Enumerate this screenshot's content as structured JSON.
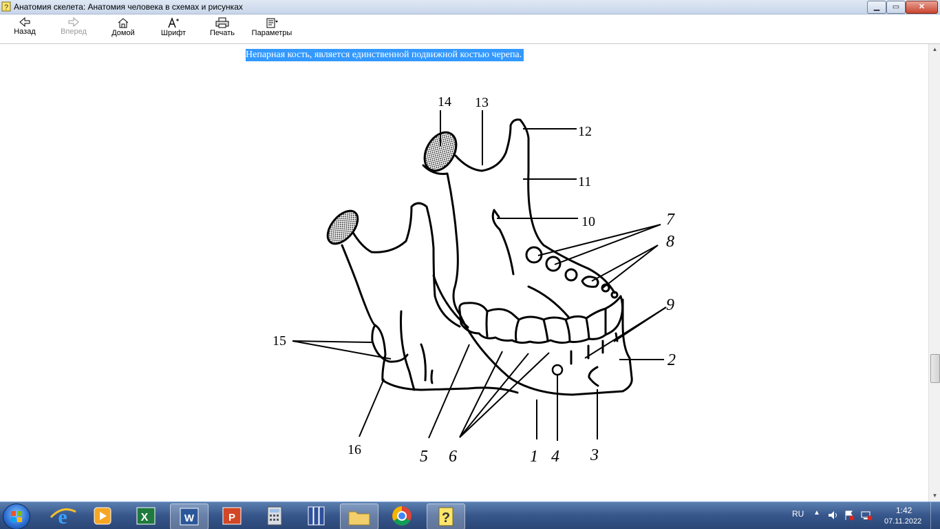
{
  "window": {
    "title": "Анатомия скелета: Анатомия человека в схемах и рисунках",
    "minimize_glyph": "▁",
    "maximize_glyph": "▭",
    "close_glyph": "✕"
  },
  "toolbar": {
    "back_label": "Назад",
    "forward_label": "Вперед",
    "home_label": "Домой",
    "font_label": "Шрифт",
    "print_label": "Печать",
    "options_label": "Параметры"
  },
  "content": {
    "selected_text": "Непарная кость, является единственной подвижной костью черепа."
  },
  "figure": {
    "labels": {
      "l1": "1",
      "l2": "2",
      "l3": "3",
      "l4": "4",
      "l5": "5",
      "l6": "6",
      "l7": "7",
      "l8": "8",
      "l9": "9",
      "l10": "10",
      "l11": "11",
      "l12": "12",
      "l13": "13",
      "l14": "14",
      "l15": "15",
      "l16": "16"
    }
  },
  "taskbar": {
    "apps": [
      "start-orb",
      "internet-explorer-icon",
      "media-player-icon",
      "excel-icon",
      "word-icon",
      "powerpoint-icon",
      "calculator-icon",
      "books-icon",
      "file-explorer-icon",
      "chrome-icon",
      "help-app-icon"
    ],
    "language": "RU",
    "time": "1:42",
    "date": "07.11.2022"
  },
  "colors": {
    "selection": "#3399ff",
    "taskbar": "#36558a"
  }
}
